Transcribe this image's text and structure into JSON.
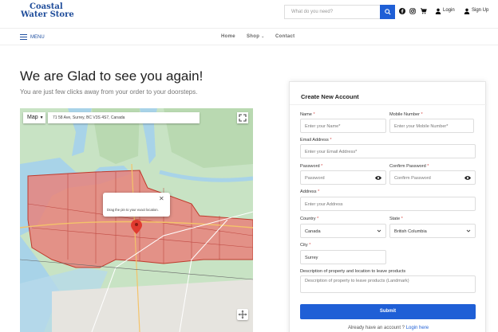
{
  "brand": {
    "line1": "Coastal",
    "line2": "Water Store"
  },
  "header": {
    "search_placeholder": "What do you need?",
    "login_label": "Login",
    "signup_label": "Sign Up",
    "icons": [
      "search-icon",
      "facebook-icon",
      "instagram-icon",
      "cart-icon",
      "user-icon",
      "user-icon"
    ]
  },
  "nav": {
    "menu_label": "MENU",
    "links": [
      "Home",
      "Shop",
      "Contact"
    ]
  },
  "hero": {
    "title": "We are Glad to see you again!",
    "subtitle": "You are just few clicks away from your order to your doorsteps."
  },
  "map": {
    "type_label": "Map",
    "address": "71 58 Ave, Surrey, BC V3S 4S7, Canada",
    "tooltip_text": "Drag the pin to your exact location."
  },
  "form": {
    "title": "Create New Account",
    "name_label": "Name",
    "name_placeholder": "Enter your Name*",
    "mobile_label": "Mobile Number",
    "mobile_placeholder": "Enter your Mobile Number*",
    "email_label": "Email Address",
    "email_placeholder": "Enter your Email Address*",
    "password_label": "Password",
    "password_placeholder": "Password",
    "confirm_label": "Confirm Password",
    "confirm_placeholder": "Confirm Password",
    "address_label": "Address",
    "address_placeholder": "Enter your Address",
    "country_label": "Country",
    "country_value": "Canada",
    "state_label": "State",
    "state_value": "British Columbia",
    "city_label": "City",
    "city_value": "Surrey",
    "desc_label": "Description of property and location to leave products",
    "desc_placeholder": "Description of property to leave products (Landmark)",
    "submit_label": "Submit",
    "already_text": "Already have an account ?",
    "login_link": "Login here",
    "required_mark": "*"
  },
  "colors": {
    "brand": "#1e4c9a",
    "accent": "#1f5fd6",
    "required": "#d9534f",
    "zone_fill": "#e8827c"
  }
}
